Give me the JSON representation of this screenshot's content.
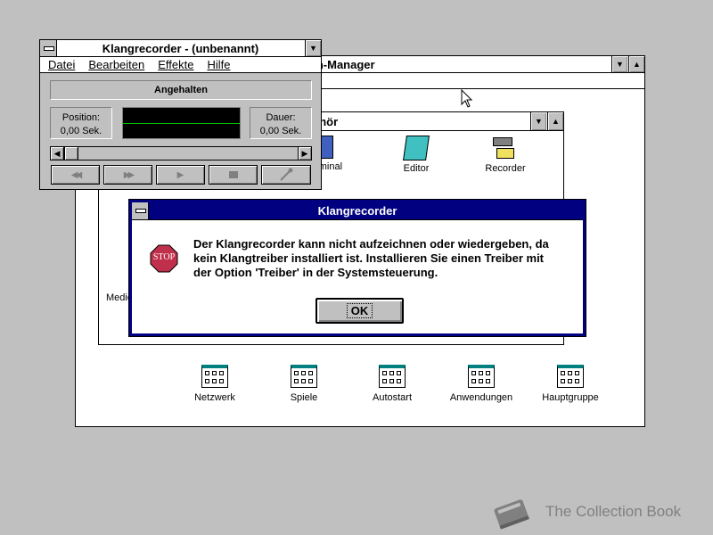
{
  "program_manager": {
    "title_visible": "ramm-Manager",
    "groups": [
      {
        "label": "Netzwerk"
      },
      {
        "label": "Spiele"
      },
      {
        "label": "Autostart"
      },
      {
        "label": "Anwendungen"
      },
      {
        "label": "Hauptgruppe"
      }
    ]
  },
  "accessories": {
    "title_visible": "ehör",
    "icons": [
      {
        "label": "erminal",
        "icon": "terminal-icon"
      },
      {
        "label": "Editor",
        "icon": "notepad-icon"
      },
      {
        "label": "Recorder",
        "icon": "recorder-icon"
      }
    ],
    "partial_label": "Medie"
  },
  "sound_recorder": {
    "title": "Klangrecorder - (unbenannt)",
    "menu": [
      "Datei",
      "Bearbeiten",
      "Effekte",
      "Hilfe"
    ],
    "status": "Angehalten",
    "position_label": "Position:",
    "position_value": "0,00 Sek.",
    "length_label": "Dauer:",
    "length_value": "0,00 Sek.",
    "buttons": [
      "rewind-icon",
      "fast-forward-icon",
      "play-icon",
      "stop-icon",
      "record-icon"
    ]
  },
  "dialog": {
    "title": "Klangrecorder",
    "stop_label": "STOP",
    "message_line1": "Der Klangrecorder kann nicht aufzeichnen oder wiedergeben, da",
    "message_line2": "kein Klangtreiber installiert ist. Installieren Sie einen Treiber mit",
    "message_line3": "der Option 'Treiber' in der Systemsteuerung.",
    "ok_label": "OK",
    "title_color": "#000080",
    "stop_color": "#c0304a"
  },
  "watermark": {
    "text": "The Collection Book"
  }
}
